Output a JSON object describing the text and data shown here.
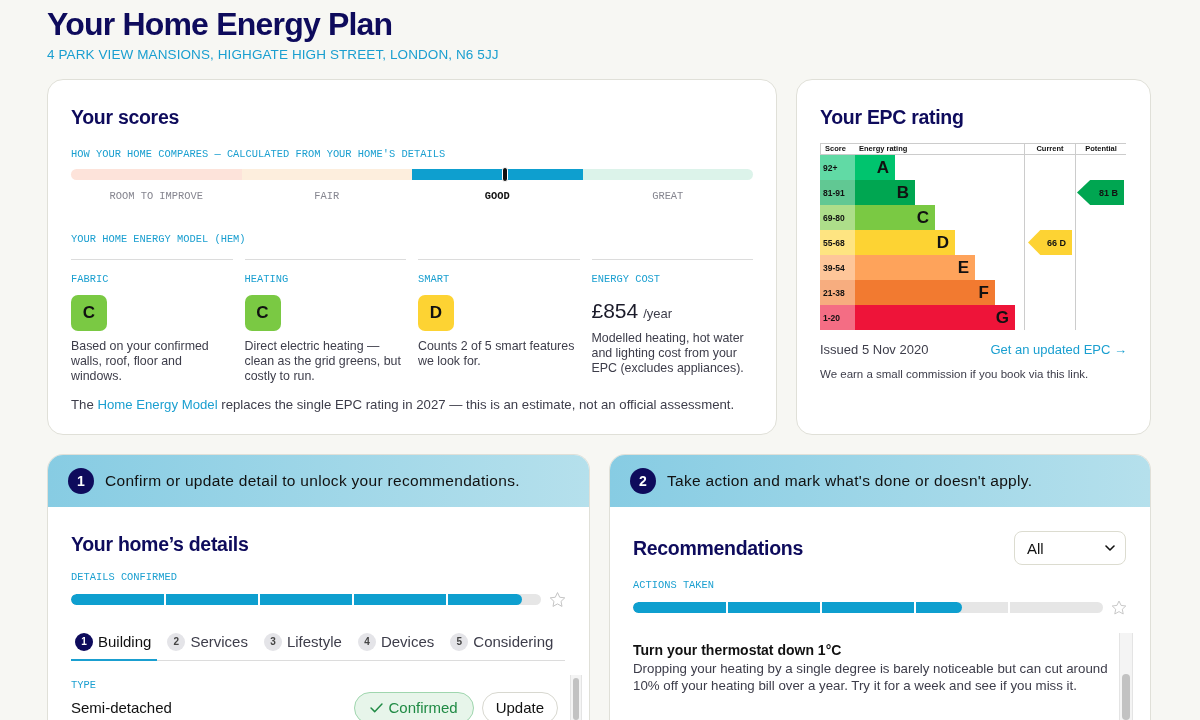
{
  "page": {
    "title": "Your Home Energy Plan",
    "address": "4 PARK VIEW MANSIONS, HIGHGATE HIGH STREET, LONDON, N6 5JJ"
  },
  "scores": {
    "title": "Your scores",
    "comparison": {
      "label": "HOW YOUR HOME COMPARES — CALCULATED FROM YOUR HOME'S DETAILS",
      "level": 0.636,
      "bands": [
        {
          "label": "ROOM TO IMPROVE",
          "selected": false,
          "color": "#fde3da"
        },
        {
          "label": "FAIR",
          "selected": false,
          "color": "#fdeedd"
        },
        {
          "label": "GOOD",
          "selected": true,
          "color": "#0e9fcf"
        },
        {
          "label": "GREAT",
          "selected": false,
          "color": "#dcf3ea"
        }
      ]
    },
    "model_label": "YOUR HOME ENERGY MODEL (HEM)",
    "metrics": [
      {
        "kind": "grade",
        "label": "FABRIC",
        "grade": "C",
        "color": "#7ac943",
        "description": "Based on your confirmed walls, roof, floor and windows."
      },
      {
        "kind": "grade",
        "label": "HEATING",
        "grade": "C",
        "color": "#7ac943",
        "description": "Direct electric heating — clean as the grid greens, but costly to run."
      },
      {
        "kind": "grade",
        "label": "SMART",
        "grade": "D",
        "color": "#fdd333",
        "description": "Counts 2 of 5 smart features we look for."
      },
      {
        "kind": "cost",
        "label": "ENERGY COST",
        "value": "£854",
        "unit": "/year",
        "description": "Modelled heating, hot water and lighting cost from your EPC (excludes appliances)."
      }
    ],
    "note": {
      "before": "The ",
      "link": "Home Energy Model",
      "after": " replaces the single EPC rating in 2027 — this is an estimate, not an official assessment."
    }
  },
  "epc": {
    "title": "Your EPC rating",
    "columns": [
      "Score",
      "Energy rating",
      "Current",
      "Potential"
    ],
    "bands": [
      {
        "score": "92+",
        "letter": "A",
        "color": "#00c46e"
      },
      {
        "score": "81-91",
        "letter": "B",
        "color": "#00a651",
        "potential": "81 B"
      },
      {
        "score": "69-80",
        "letter": "C",
        "color": "#7ac943"
      },
      {
        "score": "55-68",
        "letter": "D",
        "color": "#fdd333",
        "current": "66 D"
      },
      {
        "score": "39-54",
        "letter": "E",
        "color": "#fea35b"
      },
      {
        "score": "21-38",
        "letter": "F",
        "color": "#f27a30"
      },
      {
        "score": "1-20",
        "letter": "G",
        "color": "#ee1439"
      }
    ],
    "issued": "Issued 5 Nov 2020",
    "link": "Get an updated EPC →",
    "disclaimer": "We earn a small commission if you book via this link."
  },
  "details_panel": {
    "step": "1",
    "instruction": "Confirm or update detail to unlock your recommendations.",
    "title": "Your home’s details",
    "progress": {
      "label": "DETAILS CONFIRMED",
      "level": 0.96
    },
    "tabs": [
      {
        "number": "1",
        "label": "Building",
        "selected": true
      },
      {
        "number": "2",
        "label": "Services",
        "selected": false
      },
      {
        "number": "3",
        "label": "Lifestyle",
        "selected": false
      },
      {
        "number": "4",
        "label": "Devices",
        "selected": false
      },
      {
        "number": "5",
        "label": "Considering",
        "selected": false
      }
    ],
    "fields": [
      {
        "label": "TYPE",
        "value": "Semi-detached",
        "confirmed": true,
        "status": "Confirmed",
        "action": "Update"
      }
    ]
  },
  "recommendations_panel": {
    "step": "2",
    "instruction": "Take action and mark what's done or doesn't apply.",
    "title": "Recommendations",
    "filter": {
      "value": "All"
    },
    "progress": {
      "label": "ACTIONS TAKEN",
      "level": 0.7
    },
    "items": [
      {
        "title": "Turn your thermostat down 1°C",
        "description": "Dropping your heating by a single degree is barely noticeable but can cut around 10% off your heating bill over a year. Try it for a week and see if you miss it."
      }
    ]
  }
}
